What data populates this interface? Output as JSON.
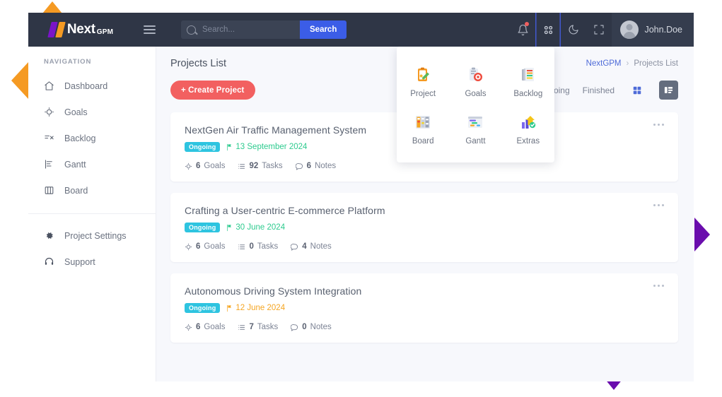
{
  "header": {
    "brand_name": "Next",
    "brand_suffix": "GPM",
    "menu_icon": "hamburger-icon",
    "search_placeholder": "Search...",
    "search_value": "",
    "search_button": "Search",
    "notification_icon": "bell-icon",
    "apps_icon": "grid-apps-icon",
    "theme_icon": "moon-icon",
    "fullscreen_icon": "expand-icon",
    "user_name": "John.Doe"
  },
  "apps_menu": {
    "items": [
      {
        "label": "Project",
        "icon": "clipboard-pencil-icon"
      },
      {
        "label": "Goals",
        "icon": "clipboard-target-icon"
      },
      {
        "label": "Backlog",
        "icon": "stacked-documents-icon"
      },
      {
        "label": "Board",
        "icon": "kanban-board-icon"
      },
      {
        "label": "Gantt",
        "icon": "gantt-chart-icon"
      },
      {
        "label": "Extras",
        "icon": "growth-arrow-check-icon"
      }
    ]
  },
  "sidebar": {
    "title": "NAVIGATION",
    "items": [
      {
        "label": "Dashboard",
        "icon": "home-icon"
      },
      {
        "label": "Goals",
        "icon": "target-icon"
      },
      {
        "label": "Backlog",
        "icon": "backlog-icon"
      },
      {
        "label": "Gantt",
        "icon": "gantt-icon"
      },
      {
        "label": "Board",
        "icon": "board-icon"
      }
    ],
    "footer_items": [
      {
        "label": "Project Settings",
        "icon": "gear-icon"
      },
      {
        "label": "Support",
        "icon": "headset-icon"
      }
    ]
  },
  "main": {
    "page_title": "Projects List",
    "breadcrumb": {
      "root": "NextGPM",
      "separator": "›",
      "current": "Projects List"
    },
    "create_button": "+ Create Project",
    "filters": [
      {
        "label": "Ongoing"
      },
      {
        "label": "Finished"
      }
    ],
    "view_grid_icon": "grid-view-icon",
    "view_list_icon": "list-view-icon",
    "card_menu_icon": "ellipsis-icon"
  },
  "colors": {
    "accent_blue": "#3b5de7",
    "create_red": "#f26060",
    "badge_cyan": "#2ec4e0",
    "date_green": "#2ecb8f",
    "date_orange": "#f5a623",
    "header_bg": "#2f3646",
    "decor_orange": "#f59a23",
    "decor_purple": "#6a0dad"
  },
  "projects": [
    {
      "title": "NextGen Air Traffic Management System",
      "status": "Ongoing",
      "date": "13 September 2024",
      "date_color": "#2ecb8f",
      "goals": "6",
      "goals_label": "Goals",
      "tasks": "92",
      "tasks_label": "Tasks",
      "notes": "6",
      "notes_label": "Notes"
    },
    {
      "title": "Crafting a User-centric E-commerce Platform",
      "status": "Ongoing",
      "date": "30 June 2024",
      "date_color": "#2ecb8f",
      "goals": "6",
      "goals_label": "Goals",
      "tasks": "0",
      "tasks_label": "Tasks",
      "notes": "4",
      "notes_label": "Notes"
    },
    {
      "title": "Autonomous Driving System Integration",
      "status": "Ongoing",
      "date": "12 June 2024",
      "date_color": "#f5a623",
      "goals": "6",
      "goals_label": "Goals",
      "tasks": "7",
      "tasks_label": "Tasks",
      "notes": "0",
      "notes_label": "Notes"
    }
  ]
}
